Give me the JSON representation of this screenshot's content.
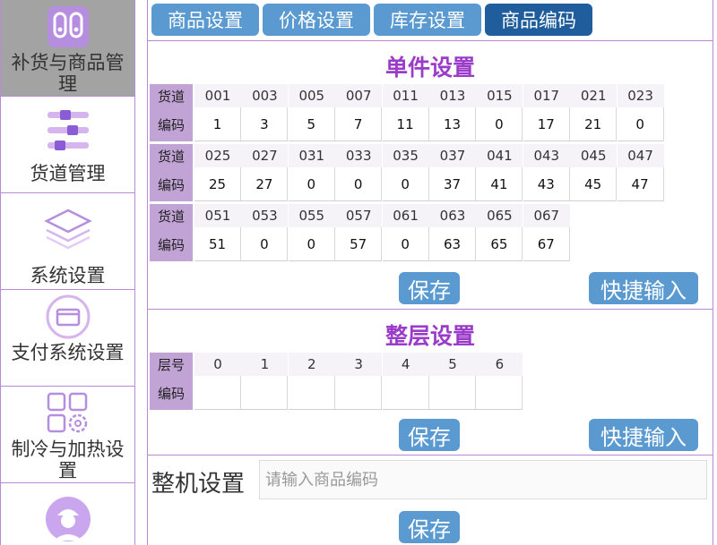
{
  "sidebar": {
    "items": [
      {
        "label": "补货与商品管理",
        "icon": "restock-icon",
        "active": true
      },
      {
        "label": "货道管理",
        "icon": "channel-icon",
        "active": false
      },
      {
        "label": "系统设置",
        "icon": "layers-icon",
        "active": false
      },
      {
        "label": "支付系统设置",
        "icon": "card-icon",
        "active": false
      },
      {
        "label": "制冷与加热设置",
        "icon": "grid-gear-icon",
        "active": false
      },
      {
        "label": "",
        "icon": "user-avatar-icon",
        "active": false
      }
    ]
  },
  "tabs": [
    {
      "label": "商品设置",
      "active": false
    },
    {
      "label": "价格设置",
      "active": false
    },
    {
      "label": "库存设置",
      "active": false
    },
    {
      "label": "商品编码",
      "active": true
    }
  ],
  "single": {
    "title": "单件设置",
    "channel_label": "货道",
    "code_label": "编码",
    "rows": [
      {
        "channels": [
          "001",
          "003",
          "005",
          "007",
          "011",
          "013",
          "015",
          "017",
          "021",
          "023"
        ],
        "codes": [
          "1",
          "3",
          "5",
          "7",
          "11",
          "13",
          "0",
          "17",
          "21",
          "0"
        ]
      },
      {
        "channels": [
          "025",
          "027",
          "031",
          "033",
          "035",
          "037",
          "041",
          "043",
          "045",
          "047"
        ],
        "codes": [
          "25",
          "27",
          "0",
          "0",
          "0",
          "37",
          "41",
          "43",
          "45",
          "47"
        ]
      },
      {
        "channels": [
          "051",
          "053",
          "055",
          "057",
          "061",
          "063",
          "065",
          "067"
        ],
        "codes": [
          "51",
          "0",
          "0",
          "57",
          "0",
          "63",
          "65",
          "67"
        ]
      }
    ],
    "save_label": "保存",
    "quick_label": "快捷输入"
  },
  "layer": {
    "title": "整层设置",
    "layer_label": "层号",
    "code_label": "编码",
    "layers": [
      "0",
      "1",
      "2",
      "3",
      "4",
      "5",
      "6"
    ],
    "codes": [
      "",
      "",
      "",
      "",
      "",
      "",
      ""
    ],
    "save_label": "保存",
    "quick_label": "快捷输入"
  },
  "machine": {
    "label": "整机设置",
    "placeholder": "请输入商品编码",
    "value": "",
    "save_label": "保存"
  },
  "colors": {
    "accent": "#9b3bc9",
    "tab": "#5a9ad0",
    "tab_active": "#1f5d9c",
    "row_head": "#c1a3d6",
    "border": "#b98ad6"
  }
}
